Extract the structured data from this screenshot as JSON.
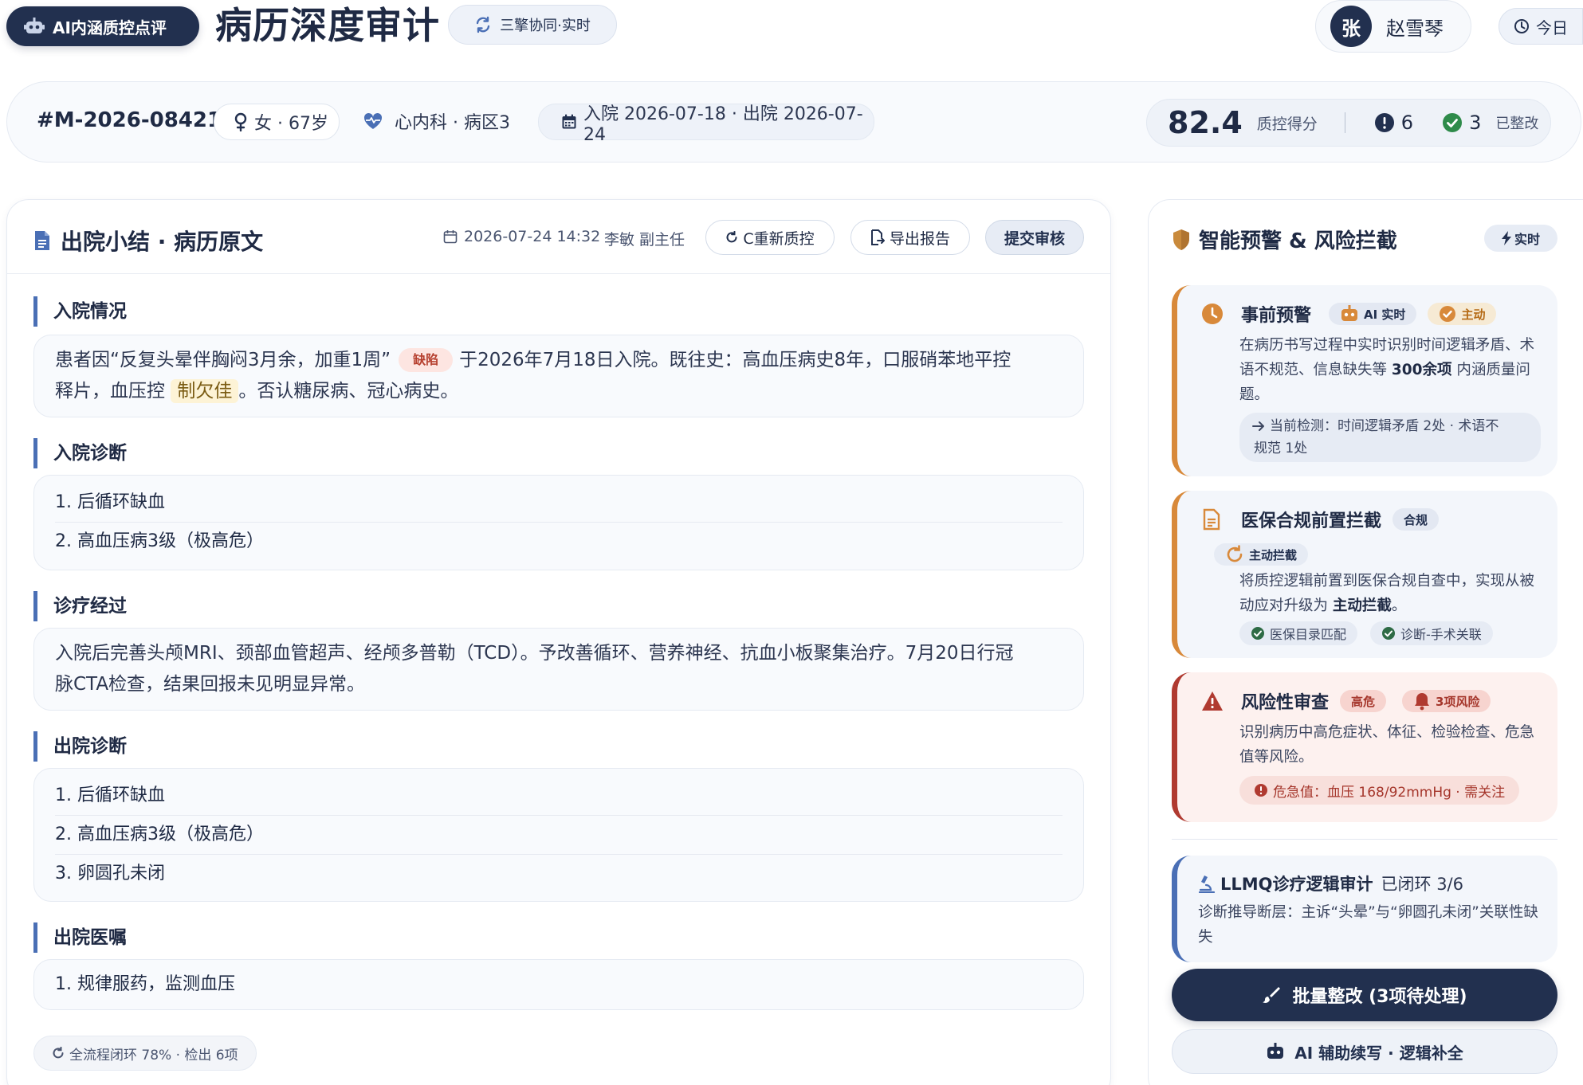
{
  "header": {
    "ai_badge": "AI内涵质控点评",
    "title": "病历深度审计",
    "sync_label": "三擎协同·实时",
    "user_avatar": "张",
    "user_name": "赵雪琴",
    "today_label": "今日"
  },
  "patient": {
    "record_id": "#M-2026-08421",
    "gender_age": "女 · 67岁",
    "department": "心内科 · 病区3",
    "dates": "入院 2026-07-18 · 出院 2026-07-24",
    "score": "82.4",
    "score_label": "质控得分",
    "issue_count": "6",
    "fixed_count": "3",
    "fixed_label": "已整改"
  },
  "document": {
    "title": "出院小结 · 病历原文",
    "timestamp": "2026-07-24 14:32",
    "doctor": "李敏 副主任",
    "btn_requc": "C重新质控",
    "btn_export": "导出报告",
    "btn_submit": "提交审核",
    "sections": {
      "admission": {
        "heading": "入院情况",
        "text_part1": "患者因“反复头晕伴胸闷3月余，加重1周”",
        "defect_tag": "缺陷",
        "text_part2": "于2026年7月18日入院。既往史：高血压病史8年，口服硝苯地平控",
        "text_part3": "释片，血压控",
        "highlight": "制欠佳",
        "text_part4": "。否认糖尿病、冠心病史。"
      },
      "admission_diag": {
        "heading": "入院诊断",
        "items": [
          "1. 后循环缺血",
          "2. 高血压病3级（极高危）"
        ]
      },
      "treatment": {
        "heading": "诊疗经过",
        "text_line1": "入院后完善头颅MRI、颈部血管超声、经颅多普勒（TCD）。予改善循环、营养神经、抗血小板聚集治疗。7月20日行冠",
        "text_line2": "脉CTA检查，结果回报未见明显异常。"
      },
      "discharge_diag": {
        "heading": "出院诊断",
        "items": [
          "1. 后循环缺血",
          "2. 高血压病3级（极高危）",
          "3. 卵圆孔未闭"
        ]
      },
      "discharge_orders": {
        "heading": "出院医嘱",
        "items": [
          "1. 规律服药，监测血压"
        ]
      }
    },
    "status": "全流程闭环 78% · 检出 6项"
  },
  "sidebar": {
    "title": "智能预警 & 风险拦截",
    "realtime_badge": "实时",
    "pre_warning": {
      "title": "事前预警",
      "badge_ai": "AI 实时",
      "badge_active": "主动",
      "text_a": "在病历书写过程中实时识别时间逻辑矛盾、术语不规范、信息缺失等 ",
      "text_bold": "300余项",
      "text_b": " 内涵质量问题。",
      "sub_line1": "当前检测：时间逻辑矛盾 2处 · 术语不",
      "sub_line2": "规范 1处"
    },
    "compliance": {
      "title": "医保合规前置拦截",
      "badge_compliant": "合规",
      "badge_active": "主动拦截",
      "text_a": "将质控逻辑前置到医保合规自查中，实现从被动应对升级为 ",
      "text_bold": "主动拦截",
      "text_b": "。",
      "chip1": "医保目录匹配",
      "chip2": "诊断-手术关联"
    },
    "risk": {
      "title": "风险性审查",
      "badge_high": "高危",
      "badge_count": "3项风险",
      "text": "识别病历中高危症状、体征、检验检查、危急值等风险。",
      "critical": "危急值：血压 168/92mmHg · 需关注"
    },
    "llmq": {
      "title": "LLMQ诊疗逻辑审计",
      "status": "已闭环 3/6",
      "text": "诊断推导断层：主诉“头晕”与“卵圆孔未闭”关联性缺失"
    },
    "btn_batch": "批量整改 (3项待处理)",
    "btn_ai_assist": "AI 辅助续写 · 逻辑补全"
  },
  "colors": {
    "navy": "#22304f",
    "accent_blue": "#4a6fb5",
    "warning_orange": "#d8893a",
    "danger_red": "#b03a30",
    "success_green": "#2e8b4a"
  }
}
